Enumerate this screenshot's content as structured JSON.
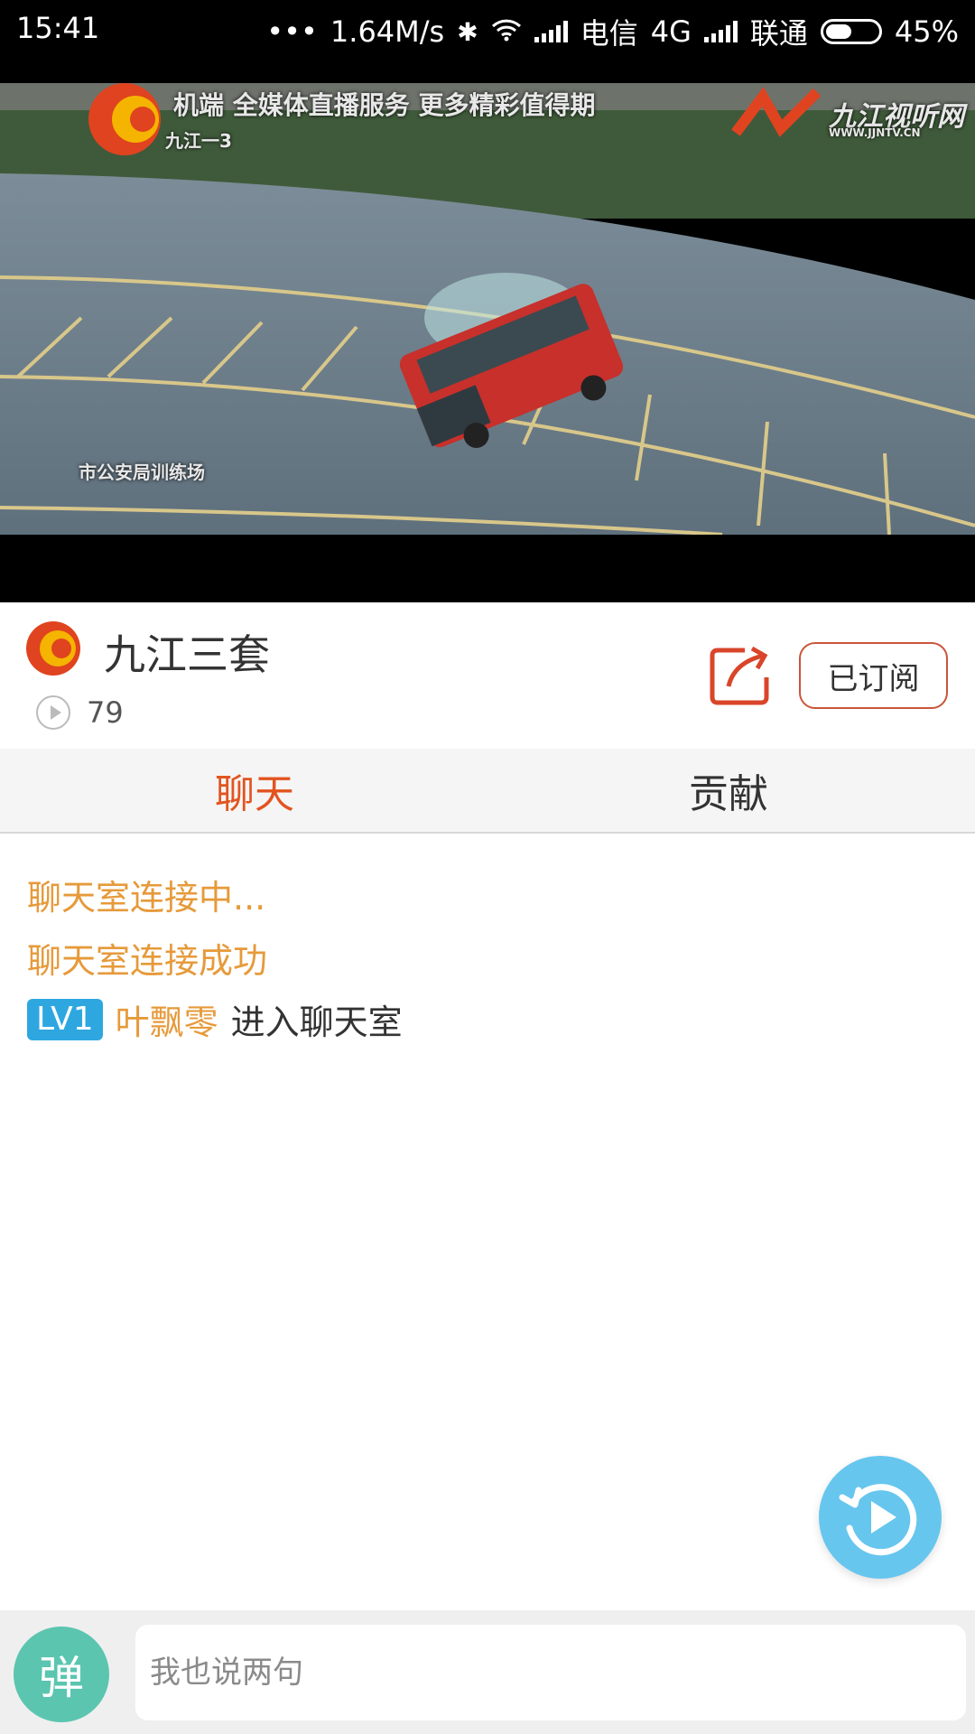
{
  "status_bar": {
    "time": "15:41",
    "dots": "•••",
    "speed": "1.64M/s",
    "carrier1": "电信",
    "network1": "4G",
    "carrier2": "联通",
    "battery": "45%",
    "battery_level": 0.45
  },
  "video": {
    "ticker": "机端  全媒体直播服务  更多精彩值得期",
    "channel_tag": "九江一3",
    "watermark": "九江视听网",
    "watermark_url": "WWW.JJNTV.CN",
    "caption": "市公安局训练场"
  },
  "channel": {
    "name": "九江三套",
    "views": "79",
    "subscribe_label": "已订阅"
  },
  "tabs": [
    {
      "label": "聊天",
      "active": true
    },
    {
      "label": "贡献",
      "active": false
    }
  ],
  "chat": {
    "messages": [
      {
        "text": "聊天室连接中..."
      },
      {
        "text": "聊天室连接成功"
      }
    ],
    "user_entry": {
      "level": "LV1",
      "name": "叶飘零",
      "action": "进入聊天室"
    }
  },
  "input_bar": {
    "danmu_label": "弹",
    "placeholder": "我也说两句"
  },
  "colors": {
    "accent": "#e2541f",
    "chat_system": "#e69a3a",
    "level_badge": "#2ea7e0",
    "fab": "#66c6ee",
    "danmu": "#5bc5b0"
  }
}
